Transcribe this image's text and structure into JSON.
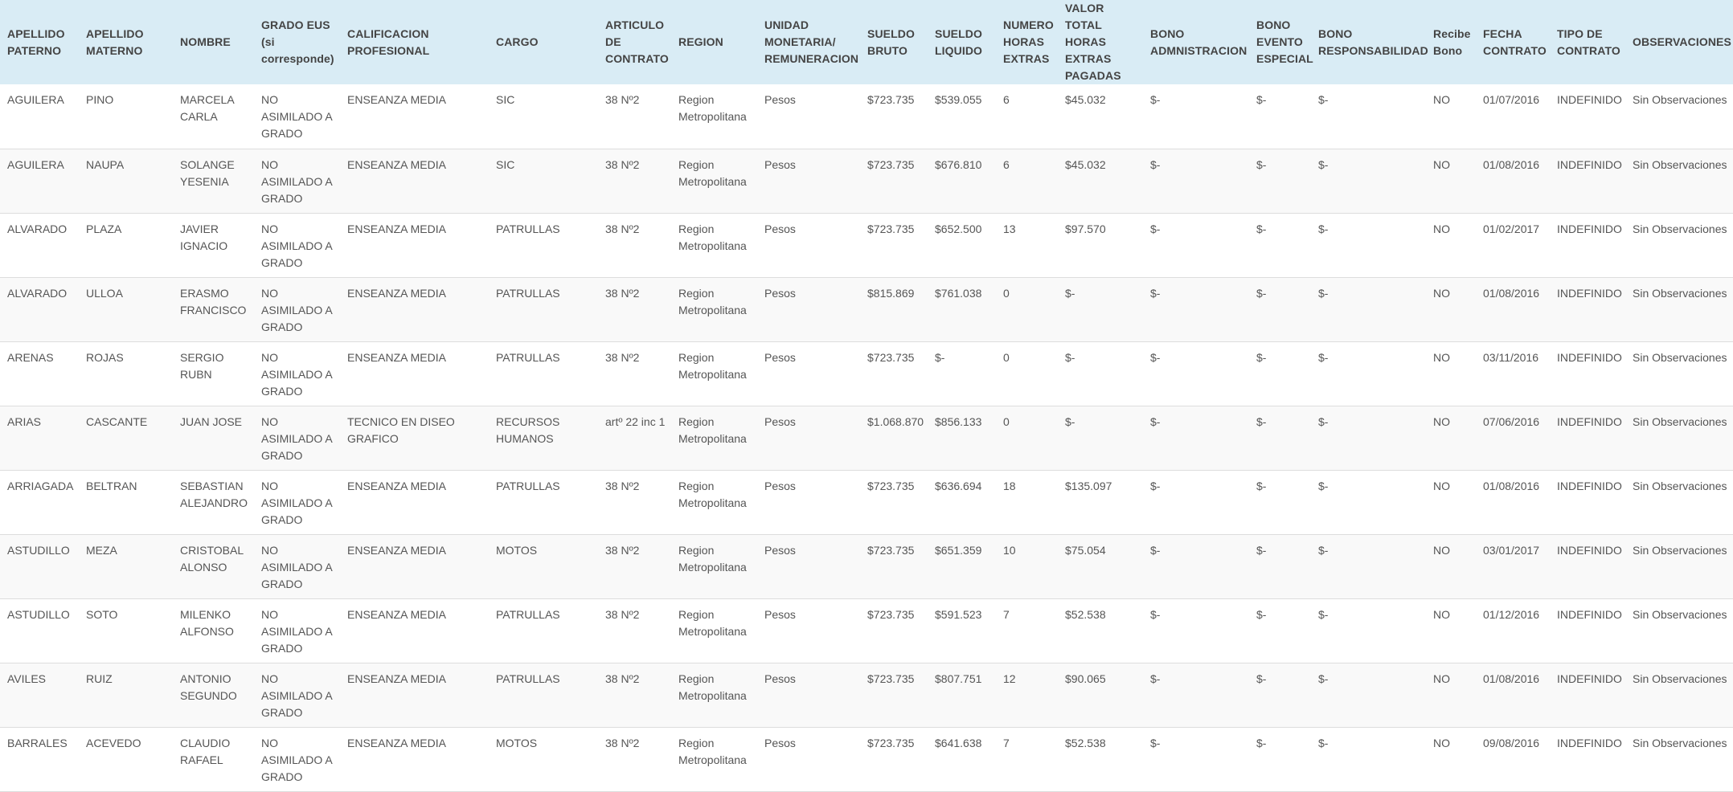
{
  "table": {
    "headers": [
      "APELLIDO PATERNO",
      "APELLIDO MATERNO",
      "NOMBRE",
      "GRADO EUS (si corresponde)",
      "CALIFICACION PROFESIONAL",
      "CARGO",
      "ARTICULO DE CONTRATO",
      "REGION",
      "UNIDAD MONETARIA/ REMUNERACION",
      "SUELDO BRUTO",
      "SUELDO LIQUIDO",
      "NUMERO HORAS EXTRAS",
      "VALOR TOTAL HORAS EXTRAS PAGADAS",
      "BONO ADMNISTRACION",
      "BONO EVENTO ESPECIAL",
      "BONO RESPONSABILIDAD",
      "Recibe Bono",
      "FECHA CONTRATO",
      "TIPO DE CONTRATO",
      "OBSERVACIONES"
    ],
    "rows": [
      [
        "AGUILERA",
        "PINO",
        "MARCELA CARLA",
        "NO ASIMILADO A GRADO",
        "ENSEANZA MEDIA",
        "SIC",
        "38 Nº2",
        "Region Metropolitana",
        "Pesos",
        "$723.735",
        "$539.055",
        "6",
        "$45.032",
        "$-",
        "$-",
        "$-",
        "NO",
        "01/07/2016",
        "INDEFINIDO",
        "Sin Observaciones"
      ],
      [
        "AGUILERA",
        "NAUPA",
        "SOLANGE YESENIA",
        "NO ASIMILADO A GRADO",
        "ENSEANZA MEDIA",
        "SIC",
        "38 Nº2",
        "Region Metropolitana",
        "Pesos",
        "$723.735",
        "$676.810",
        "6",
        "$45.032",
        "$-",
        "$-",
        "$-",
        "NO",
        "01/08/2016",
        "INDEFINIDO",
        "Sin Observaciones"
      ],
      [
        "ALVARADO",
        "PLAZA",
        "JAVIER IGNACIO",
        "NO ASIMILADO A GRADO",
        "ENSEANZA MEDIA",
        "PATRULLAS",
        "38 Nº2",
        "Region Metropolitana",
        "Pesos",
        "$723.735",
        "$652.500",
        "13",
        "$97.570",
        "$-",
        "$-",
        "$-",
        "NO",
        "01/02/2017",
        "INDEFINIDO",
        "Sin Observaciones"
      ],
      [
        "ALVARADO",
        "ULLOA",
        "ERASMO FRANCISCO",
        "NO ASIMILADO A GRADO",
        "ENSEANZA MEDIA",
        "PATRULLAS",
        "38 Nº2",
        "Region Metropolitana",
        "Pesos",
        "$815.869",
        "$761.038",
        "0",
        "$-",
        "$-",
        "$-",
        "$-",
        "NO",
        "01/08/2016",
        "INDEFINIDO",
        "Sin Observaciones"
      ],
      [
        "ARENAS",
        "ROJAS",
        "SERGIO RUBN",
        "NO ASIMILADO A GRADO",
        "ENSEANZA MEDIA",
        "PATRULLAS",
        "38 Nº2",
        "Region Metropolitana",
        "Pesos",
        "$723.735",
        "$-",
        "0",
        "$-",
        "$-",
        "$-",
        "$-",
        "NO",
        "03/11/2016",
        "INDEFINIDO",
        "Sin Observaciones"
      ],
      [
        "ARIAS",
        "CASCANTE",
        "JUAN JOSE",
        "NO ASIMILADO A GRADO",
        "TECNICO EN DISEO GRAFICO",
        "RECURSOS HUMANOS",
        "artº 22 inc 1",
        "Region Metropolitana",
        "Pesos",
        "$1.068.870",
        "$856.133",
        "0",
        "$-",
        "$-",
        "$-",
        "$-",
        "NO",
        "07/06/2016",
        "INDEFINIDO",
        "Sin Observaciones"
      ],
      [
        "ARRIAGADA",
        "BELTRAN",
        "SEBASTIAN ALEJANDRO",
        "NO ASIMILADO A GRADO",
        "ENSEANZA MEDIA",
        "PATRULLAS",
        "38 Nº2",
        "Region Metropolitana",
        "Pesos",
        "$723.735",
        "$636.694",
        "18",
        "$135.097",
        "$-",
        "$-",
        "$-",
        "NO",
        "01/08/2016",
        "INDEFINIDO",
        "Sin Observaciones"
      ],
      [
        "ASTUDILLO",
        "MEZA",
        "CRISTOBAL ALONSO",
        "NO ASIMILADO A GRADO",
        "ENSEANZA MEDIA",
        "MOTOS",
        "38 Nº2",
        "Region Metropolitana",
        "Pesos",
        "$723.735",
        "$651.359",
        "10",
        "$75.054",
        "$-",
        "$-",
        "$-",
        "NO",
        "03/01/2017",
        "INDEFINIDO",
        "Sin Observaciones"
      ],
      [
        "ASTUDILLO",
        "SOTO",
        "MILENKO ALFONSO",
        "NO ASIMILADO A GRADO",
        "ENSEANZA MEDIA",
        "PATRULLAS",
        "38 Nº2",
        "Region Metropolitana",
        "Pesos",
        "$723.735",
        "$591.523",
        "7",
        "$52.538",
        "$-",
        "$-",
        "$-",
        "NO",
        "01/12/2016",
        "INDEFINIDO",
        "Sin Observaciones"
      ],
      [
        "AVILES",
        "RUIZ",
        "ANTONIO SEGUNDO",
        "NO ASIMILADO A GRADO",
        "ENSEANZA MEDIA",
        "PATRULLAS",
        "38 Nº2",
        "Region Metropolitana",
        "Pesos",
        "$723.735",
        "$807.751",
        "12",
        "$90.065",
        "$-",
        "$-",
        "$-",
        "NO",
        "01/08/2016",
        "INDEFINIDO",
        "Sin Observaciones"
      ],
      [
        "BARRALES",
        "ACEVEDO",
        "CLAUDIO RAFAEL",
        "NO ASIMILADO A GRADO",
        "ENSEANZA MEDIA",
        "MOTOS",
        "38 Nº2",
        "Region Metropolitana",
        "Pesos",
        "$723.735",
        "$641.638",
        "7",
        "$52.538",
        "$-",
        "$-",
        "$-",
        "NO",
        "09/08/2016",
        "INDEFINIDO",
        "Sin Observaciones"
      ]
    ]
  }
}
